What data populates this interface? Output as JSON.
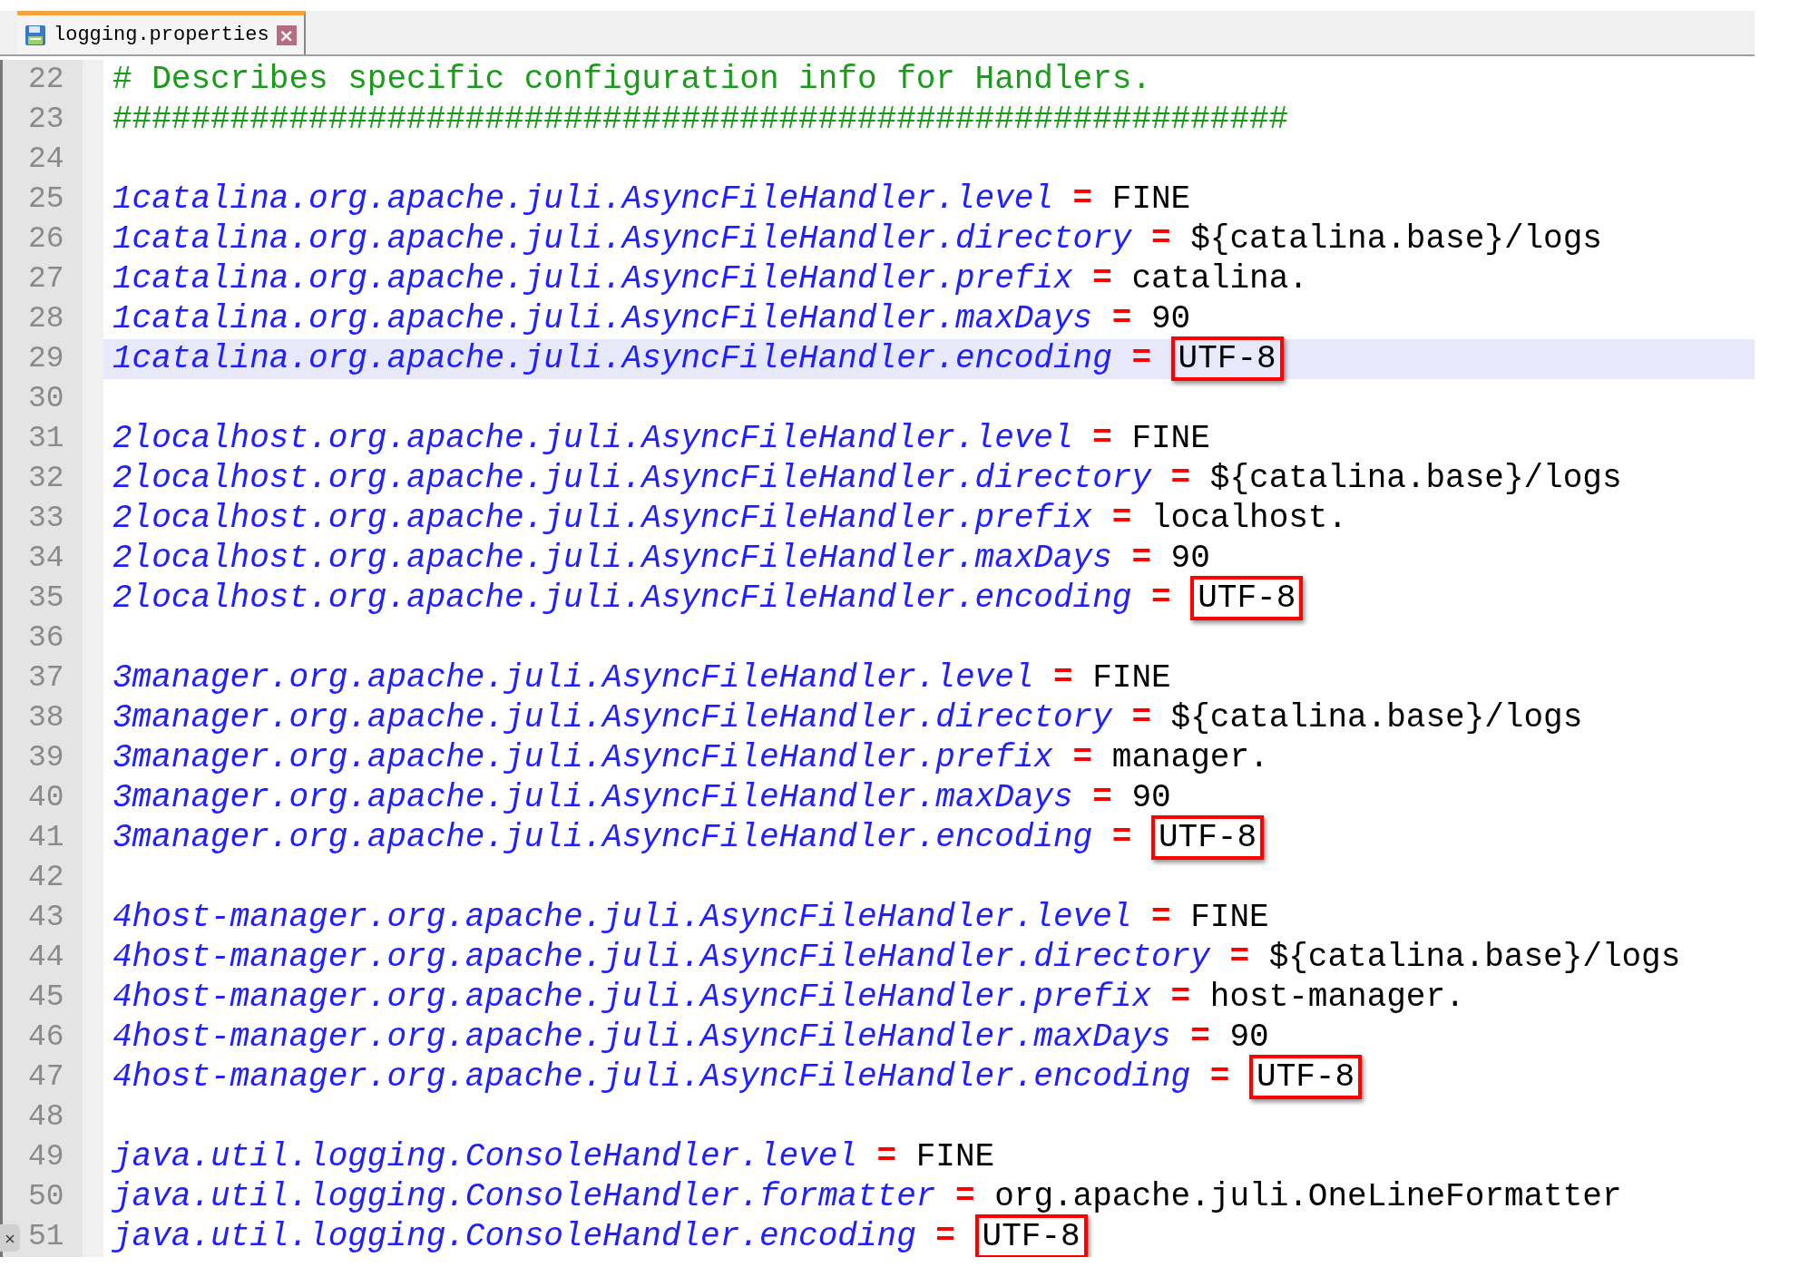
{
  "tab": {
    "title": "logging.properties",
    "close": "×",
    "selected": true
  },
  "side_close": "×",
  "lines": [
    {
      "number": "22",
      "kind": "comment",
      "text": "# Describes specific configuration info for Handlers."
    },
    {
      "number": "23",
      "kind": "comment",
      "text": "############################################################"
    },
    {
      "number": "24",
      "kind": "blank"
    },
    {
      "number": "25",
      "kind": "property",
      "key": "1catalina.org.apache.juli.AsyncFileHandler.level",
      "equals": "=",
      "value": "FINE",
      "boxed": false,
      "current": false
    },
    {
      "number": "26",
      "kind": "property",
      "key": "1catalina.org.apache.juli.AsyncFileHandler.directory",
      "equals": "=",
      "value": "${catalina.base}/logs",
      "boxed": false,
      "current": false
    },
    {
      "number": "27",
      "kind": "property",
      "key": "1catalina.org.apache.juli.AsyncFileHandler.prefix",
      "equals": "=",
      "value": "catalina.",
      "boxed": false,
      "current": false
    },
    {
      "number": "28",
      "kind": "property",
      "key": "1catalina.org.apache.juli.AsyncFileHandler.maxDays",
      "equals": "=",
      "value": "90",
      "boxed": false,
      "current": false
    },
    {
      "number": "29",
      "kind": "property",
      "key": "1catalina.org.apache.juli.AsyncFileHandler.encoding",
      "equals": "=",
      "value": "UTF-8",
      "boxed": true,
      "current": true
    },
    {
      "number": "30",
      "kind": "blank"
    },
    {
      "number": "31",
      "kind": "property",
      "key": "2localhost.org.apache.juli.AsyncFileHandler.level",
      "equals": "=",
      "value": "FINE",
      "boxed": false,
      "current": false
    },
    {
      "number": "32",
      "kind": "property",
      "key": "2localhost.org.apache.juli.AsyncFileHandler.directory",
      "equals": "=",
      "value": "${catalina.base}/logs",
      "boxed": false,
      "current": false
    },
    {
      "number": "33",
      "kind": "property",
      "key": "2localhost.org.apache.juli.AsyncFileHandler.prefix",
      "equals": "=",
      "value": "localhost.",
      "boxed": false,
      "current": false
    },
    {
      "number": "34",
      "kind": "property",
      "key": "2localhost.org.apache.juli.AsyncFileHandler.maxDays",
      "equals": "=",
      "value": "90",
      "boxed": false,
      "current": false
    },
    {
      "number": "35",
      "kind": "property",
      "key": "2localhost.org.apache.juli.AsyncFileHandler.encoding",
      "equals": "=",
      "value": "UTF-8",
      "boxed": true,
      "current": false
    },
    {
      "number": "36",
      "kind": "blank"
    },
    {
      "number": "37",
      "kind": "property",
      "key": "3manager.org.apache.juli.AsyncFileHandler.level",
      "equals": "=",
      "value": "FINE",
      "boxed": false,
      "current": false
    },
    {
      "number": "38",
      "kind": "property",
      "key": "3manager.org.apache.juli.AsyncFileHandler.directory",
      "equals": "=",
      "value": "${catalina.base}/logs",
      "boxed": false,
      "current": false
    },
    {
      "number": "39",
      "kind": "property",
      "key": "3manager.org.apache.juli.AsyncFileHandler.prefix",
      "equals": "=",
      "value": "manager.",
      "boxed": false,
      "current": false
    },
    {
      "number": "40",
      "kind": "property",
      "key": "3manager.org.apache.juli.AsyncFileHandler.maxDays",
      "equals": "=",
      "value": "90",
      "boxed": false,
      "current": false
    },
    {
      "number": "41",
      "kind": "property",
      "key": "3manager.org.apache.juli.AsyncFileHandler.encoding",
      "equals": "=",
      "value": "UTF-8",
      "boxed": true,
      "current": false
    },
    {
      "number": "42",
      "kind": "blank"
    },
    {
      "number": "43",
      "kind": "property",
      "key": "4host-manager.org.apache.juli.AsyncFileHandler.level",
      "equals": "=",
      "value": "FINE",
      "boxed": false,
      "current": false
    },
    {
      "number": "44",
      "kind": "property",
      "key": "4host-manager.org.apache.juli.AsyncFileHandler.directory",
      "equals": "=",
      "value": "${catalina.base}/logs",
      "boxed": false,
      "current": false
    },
    {
      "number": "45",
      "kind": "property",
      "key": "4host-manager.org.apache.juli.AsyncFileHandler.prefix",
      "equals": "=",
      "value": "host-manager.",
      "boxed": false,
      "current": false
    },
    {
      "number": "46",
      "kind": "property",
      "key": "4host-manager.org.apache.juli.AsyncFileHandler.maxDays",
      "equals": "=",
      "value": "90",
      "boxed": false,
      "current": false
    },
    {
      "number": "47",
      "kind": "property",
      "key": "4host-manager.org.apache.juli.AsyncFileHandler.encoding",
      "equals": "=",
      "value": "UTF-8",
      "boxed": true,
      "current": false
    },
    {
      "number": "48",
      "kind": "blank"
    },
    {
      "number": "49",
      "kind": "property",
      "key": "java.util.logging.ConsoleHandler.level",
      "equals": "=",
      "value": "FINE",
      "boxed": false,
      "current": false
    },
    {
      "number": "50",
      "kind": "property",
      "key": "java.util.logging.ConsoleHandler.formatter",
      "equals": "=",
      "value": "org.apache.juli.OneLineFormatter",
      "boxed": false,
      "current": false
    },
    {
      "number": "51",
      "kind": "property",
      "key": "java.util.logging.ConsoleHandler.encoding",
      "equals": "=",
      "value": "UTF-8",
      "boxed": true,
      "current": false
    }
  ]
}
